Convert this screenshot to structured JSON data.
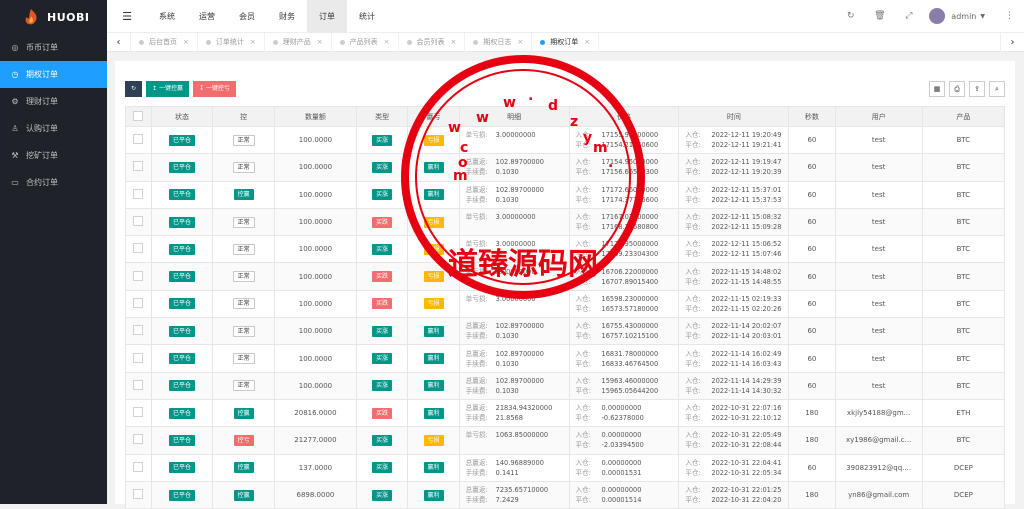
{
  "brand": {
    "name": "HUOBI",
    "accent": "#1e9fff"
  },
  "sidebar": {
    "items": [
      {
        "label": "币币订单",
        "icon": "circle-icon",
        "active": false
      },
      {
        "label": "期权订单",
        "icon": "clock-icon",
        "active": true
      },
      {
        "label": "理财订单",
        "icon": "gear-icon",
        "active": false
      },
      {
        "label": "认购订单",
        "icon": "person-icon",
        "active": false
      },
      {
        "label": "挖矿订单",
        "icon": "wrench-icon",
        "active": false
      },
      {
        "label": "合约订单",
        "icon": "monitor-icon",
        "active": false
      }
    ]
  },
  "topnav": {
    "items": [
      "系统",
      "运营",
      "会员",
      "财务",
      "订单",
      "统计"
    ],
    "active": "订单",
    "admin": "admin"
  },
  "tabs": [
    "后台首页",
    "订单统计",
    "理财产品",
    "产品列表",
    "会员列表",
    "期权日志",
    "期权订单"
  ],
  "toolbar": {
    "profit_btn": "一键控赢",
    "loss_btn": "一键控亏"
  },
  "table": {
    "headers": [
      "",
      "状态",
      "控",
      "数量额",
      "类型",
      "赢亏",
      "明细",
      "价格",
      "时间",
      "秒数",
      "用户",
      "产品"
    ],
    "rows": [
      {
        "status": "已平仓",
        "ctrl": "正常",
        "amount": "100.0000",
        "type": "买涨",
        "pl": "亏损",
        "d1l": "单亏损:",
        "d1v": "3.00000000",
        "d2l": "",
        "d2v": "",
        "p1": "17155.93000000",
        "p2": "17154.21440600",
        "t1": "2022-12-11 19:20:49",
        "t2": "2022-12-11 19:21:41",
        "sec": "60",
        "user": "test",
        "prod": "BTC"
      },
      {
        "status": "已平仓",
        "ctrl": "正常",
        "amount": "100.0000",
        "type": "买涨",
        "pl": "赢利",
        "d1l": "总赢返:",
        "d1v": "102.89700000",
        "d2l": "手续费:",
        "d2v": "0.1030",
        "p1": "17154.95000000",
        "p2": "17156.66559300",
        "t1": "2022-12-11 19:19:47",
        "t2": "2022-12-11 19:20:39",
        "sec": "60",
        "user": "test",
        "prod": "BTC"
      },
      {
        "status": "已平仓",
        "ctrl": "控赢",
        "amount": "100.0000",
        "type": "买涨",
        "pl": "赢利",
        "d1l": "总赢返:",
        "d1v": "102.89700000",
        "d2l": "手续费:",
        "d2v": "0.1030",
        "p1": "17172.66000000",
        "p2": "17174.37726600",
        "t1": "2022-12-11 15:37:01",
        "t2": "2022-12-11 15:37:53",
        "sec": "60",
        "user": "test",
        "prod": "BTC"
      },
      {
        "status": "已平仓",
        "ctrl": "正常",
        "amount": "100.0000",
        "type": "买跌",
        "pl": "亏损",
        "d1l": "单亏损:",
        "d1v": "3.00000000",
        "d2l": "",
        "d2v": "",
        "p1": "17167.07000000",
        "p2": "17168.78680800",
        "t1": "2022-12-11 15:08:32",
        "t2": "2022-12-11 15:09:28",
        "sec": "60",
        "user": "test",
        "prod": "BTC"
      },
      {
        "status": "已平仓",
        "ctrl": "正常",
        "amount": "100.0000",
        "type": "买涨",
        "pl": "亏损",
        "d1l": "单亏损:",
        "d1v": "3.00000000",
        "d2l": "",
        "d2v": "",
        "p1": "17170.95000000",
        "p2": "17169.23304300",
        "t1": "2022-12-11 15:06:52",
        "t2": "2022-12-11 15:07:46",
        "sec": "60",
        "user": "test",
        "prod": "BTC"
      },
      {
        "status": "已平仓",
        "ctrl": "正常",
        "amount": "100.0000",
        "type": "买跌",
        "pl": "亏损",
        "d1l": "单亏损:",
        "d1v": "3.00000000",
        "d2l": "",
        "d2v": "",
        "p1": "16706.22000000",
        "p2": "16707.89015400",
        "t1": "2022-11-15 14:48:02",
        "t2": "2022-11-15 14:48:55",
        "sec": "60",
        "user": "test",
        "prod": "BTC"
      },
      {
        "status": "已平仓",
        "ctrl": "正常",
        "amount": "100.0000",
        "type": "买跌",
        "pl": "亏损",
        "d1l": "单亏损:",
        "d1v": "3.00000000",
        "d2l": "",
        "d2v": "",
        "p1": "16598.23000000",
        "p2": "16573.57180000",
        "t1": "2022-11-15 02:19:33",
        "t2": "2022-11-15 02:20:26",
        "sec": "60",
        "user": "test",
        "prod": "BTC"
      },
      {
        "status": "已平仓",
        "ctrl": "正常",
        "amount": "100.0000",
        "type": "买涨",
        "pl": "赢利",
        "d1l": "总赢返:",
        "d1v": "102.89700000",
        "d2l": "手续费:",
        "d2v": "0.1030",
        "p1": "16755.43000000",
        "p2": "16757.10215100",
        "t1": "2022-11-14 20:02:07",
        "t2": "2022-11-14 20:03:01",
        "sec": "60",
        "user": "test",
        "prod": "BTC"
      },
      {
        "status": "已平仓",
        "ctrl": "正常",
        "amount": "100.0000",
        "type": "买涨",
        "pl": "赢利",
        "d1l": "总赢返:",
        "d1v": "102.89700000",
        "d2l": "手续费:",
        "d2v": "0.1030",
        "p1": "16831.78000000",
        "p2": "16833.46764500",
        "t1": "2022-11-14 16:02:49",
        "t2": "2022-11-14 16:03:43",
        "sec": "60",
        "user": "test",
        "prod": "BTC"
      },
      {
        "status": "已平仓",
        "ctrl": "正常",
        "amount": "100.0000",
        "type": "买涨",
        "pl": "赢利",
        "d1l": "总赢返:",
        "d1v": "102.89700000",
        "d2l": "手续费:",
        "d2v": "0.1030",
        "p1": "15963.46000000",
        "p2": "15965.05644200",
        "t1": "2022-11-14 14:29:39",
        "t2": "2022-11-14 14:30:32",
        "sec": "60",
        "user": "test",
        "prod": "BTC"
      },
      {
        "status": "已平仓",
        "ctrl": "控赢",
        "amount": "20816.0000",
        "type": "买跌",
        "pl": "赢利",
        "d1l": "总赢返:",
        "d1v": "21834.94320000",
        "d2l": "手续费:",
        "d2v": "21.8568",
        "p1": "0.00000000",
        "p2": "-0.62378000",
        "t1": "2022-10-31 22:07:16",
        "t2": "2022-10-31 22:10:12",
        "sec": "180",
        "user": "xkjly54188@gm...",
        "prod": "ETH"
      },
      {
        "status": "已平仓",
        "ctrl": "控亏",
        "amount": "21277.0000",
        "type": "买涨",
        "pl": "亏损",
        "d1l": "单亏损:",
        "d1v": "1063.85000000",
        "d2l": "",
        "d2v": "",
        "p1": "0.00000000",
        "p2": "-2.03394500",
        "t1": "2022-10-31 22:05:49",
        "t2": "2022-10-31 22:08:44",
        "sec": "180",
        "user": "xy1986@gmail.c...",
        "prod": "BTC"
      },
      {
        "status": "已平仓",
        "ctrl": "控赢",
        "amount": "137.0000",
        "type": "买涨",
        "pl": "赢利",
        "d1l": "总赢返:",
        "d1v": "140.96889000",
        "d2l": "手续费:",
        "d2v": "0.1411",
        "p1": "0.00000000",
        "p2": "0.00001531",
        "t1": "2022-10-31 22:04:41",
        "t2": "2022-10-31 22:05:34",
        "sec": "60",
        "user": "390823912@qq....",
        "prod": "DCEP"
      },
      {
        "status": "已平仓",
        "ctrl": "控赢",
        "amount": "6898.0000",
        "type": "买涨",
        "pl": "赢利",
        "d1l": "总赢返:",
        "d1v": "7235.65710000",
        "d2l": "手续费:",
        "d2v": "7.2429",
        "p1": "0.00000000",
        "p2": "0.00001514",
        "t1": "2022-10-31 22:01:25",
        "t2": "2022-10-31 22:04:20",
        "sec": "180",
        "user": "yn86@gmail.com",
        "prod": "DCEP"
      }
    ],
    "price_labels": [
      "入仓:",
      "平仓:"
    ],
    "time_labels": [
      "入仓:",
      "平仓:"
    ]
  },
  "watermark": {
    "text": "道臻源码网",
    "url_chars": [
      "w",
      "w",
      "w",
      ".",
      "d",
      "z",
      "y",
      "m",
      ".",
      "c",
      "o",
      "m"
    ],
    "color": "#e60012"
  }
}
